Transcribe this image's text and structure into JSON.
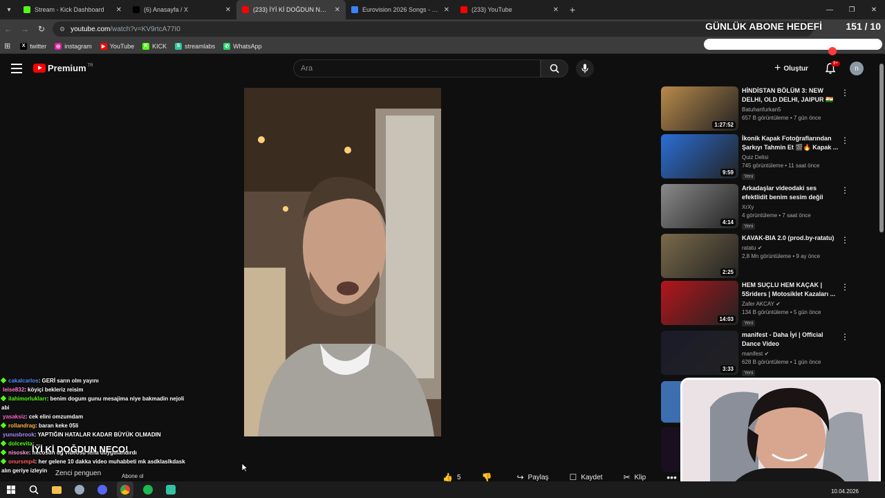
{
  "browser": {
    "tabs": [
      {
        "title": "Stream - Kick Dashboard",
        "color": "#53fc18",
        "active": false
      },
      {
        "title": "(6) Anasayfa / X",
        "color": "#000000",
        "active": false
      },
      {
        "title": "(233) İYİ Kİ DOĞDUN NECO! - Y",
        "color": "#ff0000",
        "active": true
      },
      {
        "title": "Eurovision 2026 Songs - Tier Li",
        "color": "#3b82f6",
        "active": false
      },
      {
        "title": "(233) YouTube",
        "color": "#ff0000",
        "active": false
      }
    ],
    "url_domain": "youtube.com",
    "url_path": "/watch?v=KV9rtcA77I0",
    "bookmarks": [
      {
        "label": "twitter",
        "icon": "x-icon",
        "color": "#000000",
        "glyph": "X"
      },
      {
        "label": "instagram",
        "icon": "instagram-icon",
        "color": "#d6249f",
        "glyph": "◎"
      },
      {
        "label": "YouTube",
        "icon": "youtube-icon",
        "color": "#ff0000",
        "glyph": "▶"
      },
      {
        "label": "KICK",
        "icon": "kick-icon",
        "color": "#53fc18",
        "glyph": "K"
      },
      {
        "label": "streamlabs",
        "icon": "streamlabs-icon",
        "color": "#31c3a2",
        "glyph": "S"
      },
      {
        "label": "WhatsApp",
        "icon": "whatsapp-icon",
        "color": "#25d366",
        "glyph": "✆"
      }
    ]
  },
  "goal": {
    "title": "GÜNLÜK ABONE HEDEFİ",
    "count": "151 / 10",
    "progress": 1.0
  },
  "youtube": {
    "brand": "Premium",
    "region": "TR",
    "search_placeholder": "Ara",
    "create_label": "Oluştur",
    "notif_badge": "9+",
    "avatar_letter": "n",
    "actions": {
      "like_count": "5",
      "share": "Paylaş",
      "save": "Kaydet",
      "clip": "Klip"
    },
    "recommendations": [
      {
        "title": "HİNDİSTAN BÖLÜM 3: NEW DELHI, OLD DELHI, JAIPUR 🇮🇳",
        "channel": "Batuhanfurkan5",
        "verified": false,
        "stats": "657 B görüntüleme • 7 gün önce",
        "duration": "1:27:52",
        "new": "",
        "thumb_color": "#b88a4a"
      },
      {
        "title": "İkonik Kapak Fotoğraflarından Şarkıyı Tahmin Et 🎬🔥 Kapak ...",
        "channel": "Quiz Delisi",
        "verified": false,
        "stats": "745 görüntüleme • 11 saat önce",
        "duration": "9:59",
        "new": "Yeni",
        "thumb_color": "#2b6fd6"
      },
      {
        "title": "Arkadaşlar videodaki ses efektlidit benim sesim değil",
        "channel": "XrXy",
        "verified": false,
        "stats": "4 görüntüleme • 7 saat önce",
        "duration": "4:14",
        "new": "Yeni",
        "thumb_color": "#8a8a8a"
      },
      {
        "title": "KAVAK-BIA 2.0 (prod.by-ratatu)",
        "channel": "ratatu",
        "verified": true,
        "stats": "2,8 Mn görüntüleme • 9 ay önce",
        "duration": "2:25",
        "new": "",
        "thumb_color": "#7a6a4a"
      },
      {
        "title": "HEM SUÇLU HEM KAÇAK | 5Sriders | Motosiklet Kazaları ...",
        "channel": "Zafer AKCAY",
        "verified": true,
        "stats": "134 B görüntüleme • 5 gün önce",
        "duration": "14:03",
        "new": "Yeni",
        "thumb_color": "#b3161b"
      },
      {
        "title": "manifest - Daha İyi | Official Dance Video",
        "channel": "manifest",
        "verified": true,
        "stats": "628 B görüntüleme • 1 gün önce",
        "duration": "3:33",
        "new": "Yeni",
        "thumb_color": "#1a1a2a"
      }
    ]
  },
  "chat": [
    {
      "user": "cakalcarlos",
      "color": "#4f8cff",
      "text": ": GERİ sarın olm yayını",
      "badge": true
    },
    {
      "user": "leise832",
      "color": "#ff7fd0",
      "text": ": köyiçi bekleriz reisim",
      "badge": false
    },
    {
      "user": "ilahimorluklarr",
      "color": "#53fc18",
      "text": ": benim dogum gunu mesajima niye bakmadin nejoli",
      "badge": true
    },
    {
      "user": "",
      "color": "#ffffff",
      "text": "abi",
      "badge": false
    },
    {
      "user": "yasaksiz",
      "color": "#ff66cc",
      "text": ": cek elini omzumdam",
      "badge": false
    },
    {
      "user": "rollandrag",
      "color": "#ffb347",
      "text": ": baran keke 05li",
      "badge": true
    },
    {
      "user": "yunusbrook",
      "color": "#a58cff",
      "text": ": YAPTIĞIN HATALAR KADAR BÜYÜK OLMADIN",
      "badge": false
    },
    {
      "user": "dolcevita",
      "color": "#53fc18",
      "text": ": ...",
      "badge": true
    },
    {
      "user": "nisoske",
      "color": "#ff9ad5",
      "text": ": necosun dg videosu fena duygulandırdı",
      "badge": true
    },
    {
      "user": "onursmp4",
      "color": "#ff5c5c",
      "text": ": her gelene 10 dakka video muhabbeti mk asdklaslkdask",
      "badge": true
    },
    {
      "user": "",
      "color": "#ffffff",
      "text": "alın geriye izleyin",
      "badge": false
    }
  ],
  "overlay": {
    "title_text": "İYİ Kİ DOĞDUN NECO!",
    "sub_text": "Zenci penguen",
    "abone_text": "Abone ol"
  },
  "taskbar": {
    "date": "10.04.2026"
  }
}
